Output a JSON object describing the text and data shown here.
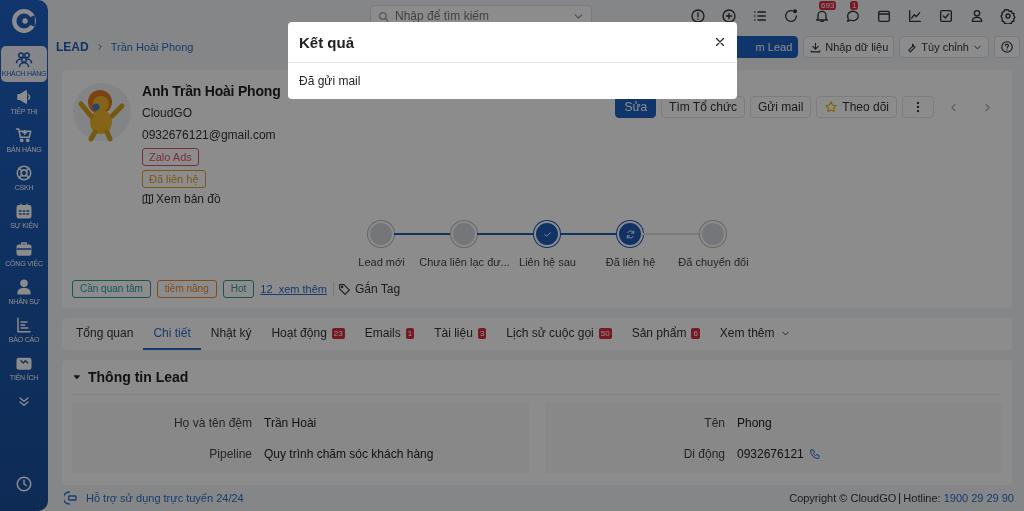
{
  "sidebar": {
    "items": [
      {
        "label": "KHÁCH HÀNG",
        "selected": true
      },
      {
        "label": "TIẾP THỊ",
        "selected": false
      },
      {
        "label": "BÁN HÀNG",
        "selected": false
      },
      {
        "label": "CSKH",
        "selected": false
      },
      {
        "label": "SỰ KIỆN",
        "selected": false
      },
      {
        "label": "CÔNG VIỆC",
        "selected": false
      },
      {
        "label": "NHÂN SỰ",
        "selected": false
      },
      {
        "label": "BÁO CÁO",
        "selected": false
      },
      {
        "label": "TIỆN ÍCH",
        "selected": false
      }
    ]
  },
  "topbar": {
    "search": {
      "placeholder": "Nhập để tìm kiếm"
    },
    "icons": [
      {
        "kind": "alert"
      },
      {
        "kind": "add"
      },
      {
        "kind": "list"
      },
      {
        "kind": "call"
      },
      {
        "kind": "bell",
        "badge": "693"
      },
      {
        "kind": "chat",
        "badge": "1"
      },
      {
        "kind": "calendar"
      },
      {
        "kind": "chart"
      },
      {
        "kind": "check"
      },
      {
        "kind": "user"
      },
      {
        "kind": "settings"
      }
    ]
  },
  "breadcrumb": [
    "LEAD",
    "Trần Hoài Phong"
  ],
  "header_actions": [
    {
      "label": "m Lead",
      "kind": "primary"
    },
    {
      "label": "Nhập dữ liệu",
      "kind": "import"
    },
    {
      "label": "Tùy chỉnh",
      "kind": "customize"
    },
    {
      "kind": "help"
    }
  ],
  "profile": {
    "name": "Anh Trần Hoài Phong",
    "company": "CloudGO",
    "email": "0932676121@gmail.com",
    "labels": [
      {
        "text": "Zalo Ads",
        "color": "#772e3d"
      },
      {
        "text": "Đã liên hệ",
        "color": "#7b581a"
      }
    ],
    "map_link": "Xem bản đồ",
    "actions": [
      {
        "label": "Sửa",
        "kind": "primary"
      },
      {
        "label": "Tìm Tổ chức",
        "kind": "plain"
      },
      {
        "label": "Gửi mail",
        "kind": "plain"
      },
      {
        "label": "Theo dõi",
        "kind": "follow"
      },
      {
        "kind": "more"
      },
      {
        "kind": "prev"
      },
      {
        "kind": "next"
      }
    ]
  },
  "pipeline": [
    {
      "label": "Lead mới",
      "kind": "plain"
    },
    {
      "label": "Chưa liên lạc đư...",
      "kind": "plain"
    },
    {
      "label": "Liên hệ sau",
      "kind": "checked"
    },
    {
      "label": "Đã liên hệ",
      "kind": "current"
    },
    {
      "label": "Đã chuyển đổi",
      "kind": "plain"
    }
  ],
  "tags": [
    {
      "text": "Cần quan tâm",
      "color": "#175658"
    },
    {
      "text": "tiềm năng",
      "color": "#804b20"
    },
    {
      "text": "Hot",
      "color": "#175658"
    }
  ],
  "tags_more": "12  xem thêm",
  "add_tag": "Gắn Tag",
  "tabs": [
    {
      "label": "Tổng quan",
      "selected": false
    },
    {
      "label": "Chi tiết",
      "selected": true
    },
    {
      "label": "Nhật ký",
      "selected": false
    },
    {
      "label": "Hoạt động",
      "badge": "23",
      "selected": false
    },
    {
      "label": "Emails",
      "badge": "1",
      "selected": false
    },
    {
      "label": "Tài liệu",
      "badge": "3",
      "selected": false
    },
    {
      "label": "Lịch sử cuộc gọi",
      "badge": "50",
      "selected": false
    },
    {
      "label": "Sản phẩm",
      "badge": "6",
      "selected": false
    },
    {
      "label": "Xem thêm",
      "kind": "more",
      "selected": false
    }
  ],
  "section": {
    "title": "Thông tin Lead",
    "expanded": true,
    "fields": [
      {
        "label": "Họ và tên đệm",
        "value": "Trần Hoài"
      },
      {
        "label": "Tên",
        "value": "Phong"
      },
      {
        "label": "Pipeline",
        "value": "Quy trình chăm sóc khách hàng"
      },
      {
        "label": "Di động",
        "value": "0932676121",
        "kind": "phone"
      }
    ]
  },
  "footer": {
    "support": "Hỗ trợ sử dụng trực tuyến 24/24",
    "copyright": "Copyright © CloudGO",
    "hotline_label": "Hotline:",
    "hotline": "1900 29 29 90"
  },
  "modal": {
    "title": "Kết quả",
    "message": "Đã gửi mail"
  }
}
